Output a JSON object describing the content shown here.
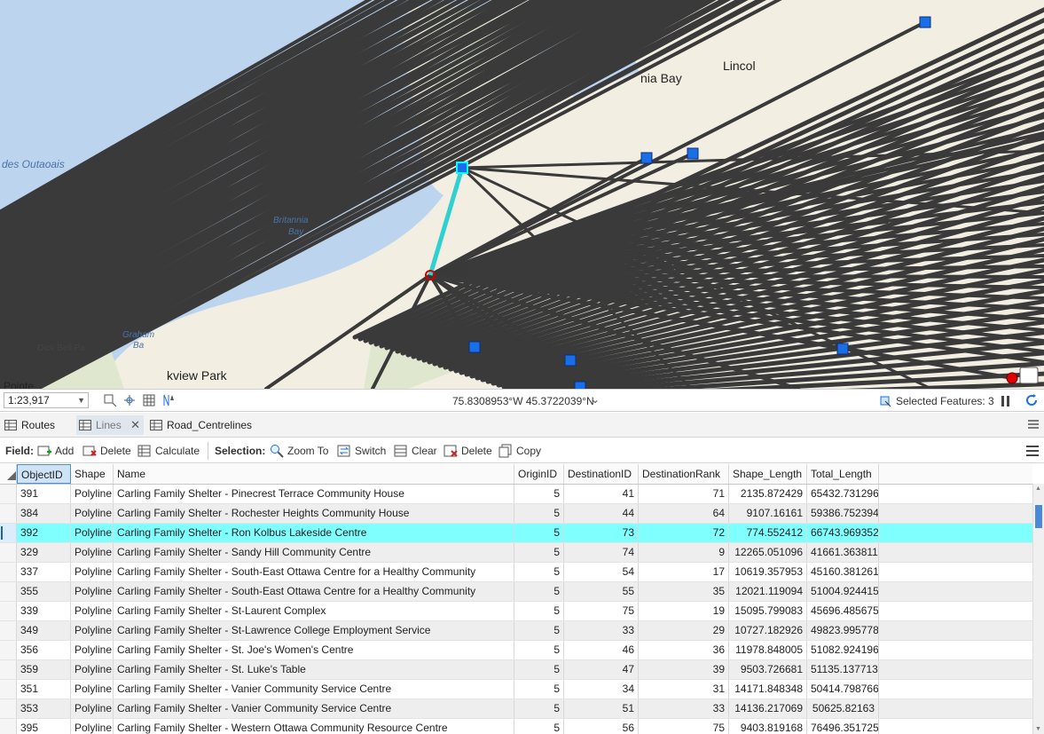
{
  "map": {
    "labels": {
      "lac_des_outaouais": "des Outaoais",
      "britannia_bay": "Britannia",
      "britannia_bay2": "Bay",
      "britannia_bay_top": "nia Bay",
      "lincoln": "Lincol",
      "dick_bell": "Dick Bell Pa",
      "lakeview_park": "kview Park",
      "pointe": "Pointe",
      "graham_bay": "Graham",
      "graham_bay2": "Ba"
    }
  },
  "status": {
    "scale": "1:23,917",
    "coordinates": "75.8308953°W 45.3722039°N",
    "selected_features": "Selected Features: 3"
  },
  "tabs": [
    {
      "label": "Routes"
    },
    {
      "label": "Lines"
    },
    {
      "label": "Road_Centrelines"
    }
  ],
  "toolbar": {
    "field_label": "Field:",
    "add": "Add",
    "delete_field": "Delete",
    "calculate": "Calculate",
    "selection_label": "Selection:",
    "zoom_to": "Zoom To",
    "switch": "Switch",
    "clear": "Clear",
    "delete_sel": "Delete",
    "copy": "Copy"
  },
  "table": {
    "columns": [
      "ObjectID",
      "Shape",
      "Name",
      "OriginID",
      "DestinationID",
      "DestinationRank",
      "Shape_Length",
      "Total_Length"
    ],
    "rows": [
      [
        "391",
        "Polyline",
        "Carling Family Shelter - Pinecrest Terrace Community House",
        "5",
        "41",
        "71",
        "2135.872429",
        "65432.731296"
      ],
      [
        "384",
        "Polyline",
        "Carling Family Shelter - Rochester Heights Community House",
        "5",
        "44",
        "64",
        "9107.16161",
        "59386.752394"
      ],
      [
        "392",
        "Polyline",
        "Carling Family Shelter - Ron Kolbus Lakeside Centre",
        "5",
        "73",
        "72",
        "774.552412",
        "66743.969352"
      ],
      [
        "329",
        "Polyline",
        "Carling Family Shelter - Sandy Hill Community Centre",
        "5",
        "74",
        "9",
        "12265.051096",
        "41661.363811"
      ],
      [
        "337",
        "Polyline",
        "Carling Family Shelter - South-East Ottawa Centre for a Healthy Community",
        "5",
        "54",
        "17",
        "10619.357953",
        "45160.381261"
      ],
      [
        "355",
        "Polyline",
        "Carling Family Shelter - South-East Ottawa Centre for a Healthy Community",
        "5",
        "55",
        "35",
        "12021.119094",
        "51004.924415"
      ],
      [
        "339",
        "Polyline",
        "Carling Family Shelter - St-Laurent Complex",
        "5",
        "75",
        "19",
        "15095.799083",
        "45696.485675"
      ],
      [
        "349",
        "Polyline",
        "Carling Family Shelter - St-Lawrence College Employment Service",
        "5",
        "33",
        "29",
        "10727.182926",
        "49823.995778"
      ],
      [
        "356",
        "Polyline",
        "Carling Family Shelter - St. Joe's Women's Centre",
        "5",
        "46",
        "36",
        "11978.848005",
        "51082.924196"
      ],
      [
        "359",
        "Polyline",
        "Carling Family Shelter - St. Luke's Table",
        "5",
        "47",
        "39",
        "9503.726681",
        "51135.137713"
      ],
      [
        "351",
        "Polyline",
        "Carling Family Shelter - Vanier Community Service Centre",
        "5",
        "34",
        "31",
        "14171.848348",
        "50414.798766"
      ],
      [
        "353",
        "Polyline",
        "Carling Family Shelter - Vanier Community Service Centre",
        "5",
        "51",
        "33",
        "14136.217069",
        "50625.82163"
      ],
      [
        "395",
        "Polyline",
        "Carling Family Shelter - Western Ottawa Community Resource Centre",
        "5",
        "56",
        "75",
        "9403.819168",
        "76496.351725"
      ]
    ],
    "highlighted_row": 2,
    "colors": {
      "highlight": "#80ffff",
      "route": "#2fd0d0",
      "line": "#3a3a3a",
      "water": "#bcd4ee",
      "land": "#f2efe2"
    }
  }
}
